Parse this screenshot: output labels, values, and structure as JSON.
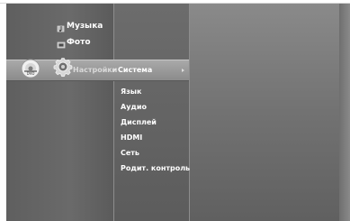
{
  "menu": {
    "items": [
      {
        "label": "Музыка",
        "icon": "music-icon"
      },
      {
        "label": "Фото",
        "icon": "photo-icon"
      },
      {
        "label": "Настройки",
        "icon": "gear-icon"
      }
    ],
    "selected": "Настройки"
  },
  "submenu": {
    "selected": "Система",
    "items": [
      "Язык",
      "Аудио",
      "Дисплей",
      "HDMI",
      "Сеть",
      "Родит. контроль"
    ]
  },
  "icons": {
    "disc": "disc-icon",
    "music": "music-icon",
    "photo": "photo-icon",
    "settings": "gear-icon",
    "bullet": "bullet-icon",
    "arrow": "arrow-right-icon"
  }
}
